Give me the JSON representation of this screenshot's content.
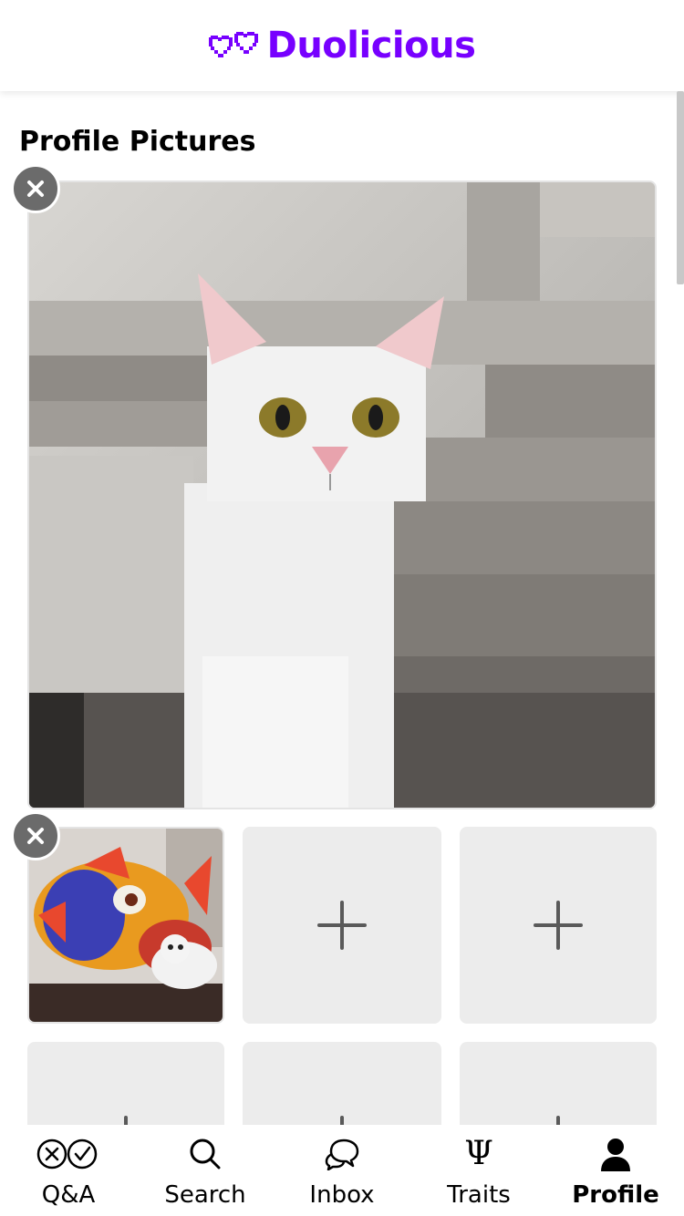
{
  "header": {
    "app_name": "Duolicious",
    "brand_color": "#7700ff",
    "logo_icon": "pixel-hearts-icon"
  },
  "main": {
    "section_title": "Profile Pictures",
    "photos": [
      {
        "state": "filled",
        "content": "cat-photo",
        "removable": true
      },
      {
        "state": "filled",
        "content": "cat-fish-costume-photo",
        "removable": true
      },
      {
        "state": "empty",
        "icon": "plus-icon"
      },
      {
        "state": "empty",
        "icon": "plus-icon"
      },
      {
        "state": "empty",
        "icon": "plus-icon"
      },
      {
        "state": "empty",
        "icon": "plus-icon"
      },
      {
        "state": "empty",
        "icon": "plus-icon"
      }
    ],
    "remove_icon": "close-icon"
  },
  "bottom_nav": {
    "items": [
      {
        "label": "Q&A",
        "icon": "qa-icon",
        "active": false
      },
      {
        "label": "Search",
        "icon": "search-icon",
        "active": false
      },
      {
        "label": "Inbox",
        "icon": "chat-bubbles-icon",
        "active": false
      },
      {
        "label": "Traits",
        "icon": "psi-icon",
        "active": false
      },
      {
        "label": "Profile",
        "icon": "person-icon",
        "active": true
      }
    ]
  }
}
